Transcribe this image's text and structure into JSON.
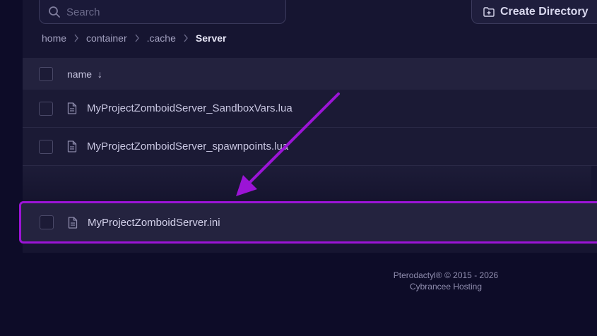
{
  "search": {
    "placeholder": "Search",
    "icon": "search-icon"
  },
  "toolbar": {
    "create_directory_label": "Create Directory",
    "create_directory_icon": "folder-plus-icon"
  },
  "breadcrumb": {
    "items": [
      "home",
      "container",
      ".cache"
    ],
    "current": "Server"
  },
  "table": {
    "column_name": "name",
    "sort_indicator": "↓",
    "rows": [
      {
        "name": "MyProjectZomboidServer_SandboxVars.lua"
      },
      {
        "name": "MyProjectZomboidServer_spawnpoints.lua"
      }
    ],
    "highlighted_row": {
      "name": "MyProjectZomboidServer.ini"
    }
  },
  "footer": {
    "line1": "Pterodactyl® © 2015 - 2026",
    "line2": "Cybrancee Hosting"
  },
  "colors": {
    "highlight": "#9b14d6",
    "background": "#0d0c28",
    "panel": "#161531"
  }
}
